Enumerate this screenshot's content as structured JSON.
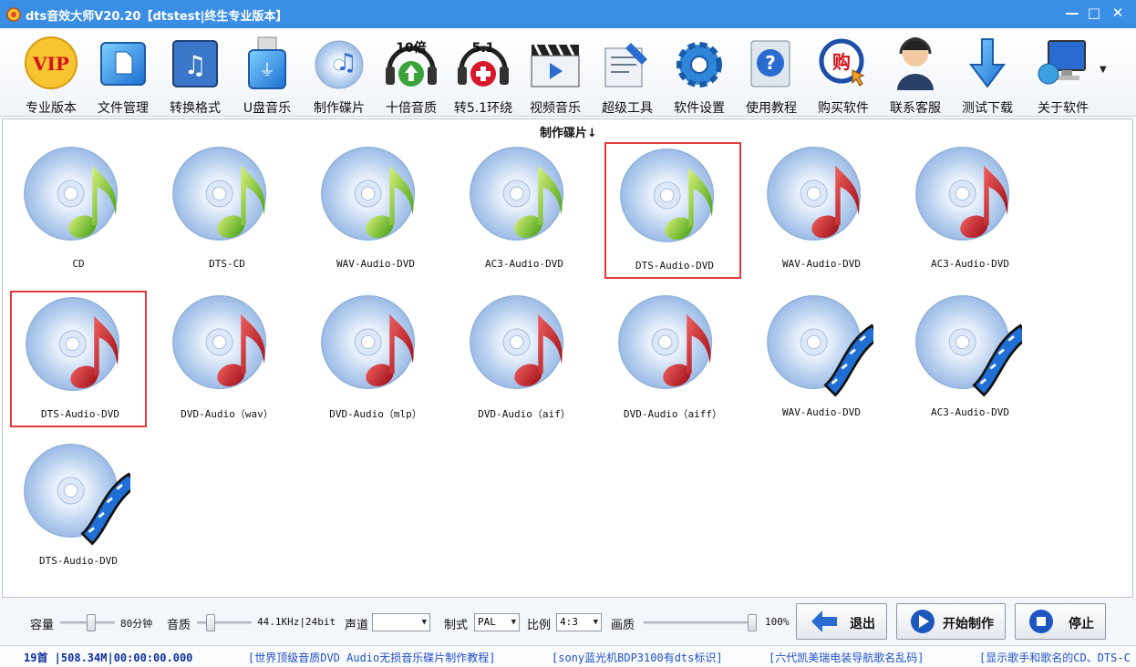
{
  "window": {
    "title": "dts音效大师V20.20【dtstest|终生专业版本】",
    "minimize": "—",
    "maximize": "□",
    "close": "✕"
  },
  "toolbar": {
    "items": [
      {
        "label": "专业版本",
        "icon": "vip-icon"
      },
      {
        "label": "文件管理",
        "icon": "file-manager-icon"
      },
      {
        "label": "转换格式",
        "icon": "convert-music-icon"
      },
      {
        "label": "U盘音乐",
        "icon": "usb-drive-icon"
      },
      {
        "label": "制作碟片",
        "icon": "make-disc-icon"
      },
      {
        "label": "十倍音质",
        "icon": "ten-times-quality-icon"
      },
      {
        "label": "转5.1环绕",
        "icon": "surround-51-icon"
      },
      {
        "label": "视频音乐",
        "icon": "video-music-icon"
      },
      {
        "label": "超级工具",
        "icon": "super-tools-icon"
      },
      {
        "label": "软件设置",
        "icon": "settings-gear-icon"
      },
      {
        "label": "使用教程",
        "icon": "help-tutorial-icon"
      },
      {
        "label": "购买软件",
        "icon": "buy-software-icon"
      },
      {
        "label": "联系客服",
        "icon": "customer-service-icon"
      },
      {
        "label": "测试下载",
        "icon": "download-arrow-icon"
      },
      {
        "label": "关于软件",
        "icon": "about-computer-icon"
      }
    ],
    "badge_10": "10倍",
    "badge_51": "5.1",
    "vip_text": "VIP",
    "buy_char": "购"
  },
  "panel": {
    "title": "制作碟片↓",
    "items": [
      {
        "label": "CD",
        "note": "green",
        "selected": false
      },
      {
        "label": "DTS-CD",
        "note": "green",
        "selected": false
      },
      {
        "label": "WAV-Audio-DVD",
        "note": "green",
        "selected": false
      },
      {
        "label": "AC3-Audio-DVD",
        "note": "green",
        "selected": false
      },
      {
        "label": "DTS-Audio-DVD",
        "note": "green",
        "selected": true
      },
      {
        "label": "WAV-Audio-DVD",
        "note": "red",
        "selected": false
      },
      {
        "label": "AC3-Audio-DVD",
        "note": "red",
        "selected": false
      },
      {
        "label": "DTS-Audio-DVD",
        "note": "red",
        "selected": true
      },
      {
        "label": "DVD-Audio（wav）",
        "note": "red",
        "selected": false
      },
      {
        "label": "DVD-Audio（mlp）",
        "note": "red",
        "selected": false
      },
      {
        "label": "DVD-Audio（aif）",
        "note": "red",
        "selected": false
      },
      {
        "label": "DVD-Audio（aiff）",
        "note": "red",
        "selected": false
      },
      {
        "label": "WAV-Audio-DVD",
        "note": "film",
        "selected": false
      },
      {
        "label": "AC3-Audio-DVD",
        "note": "film",
        "selected": false
      },
      {
        "label": "DTS-Audio-DVD",
        "note": "film",
        "selected": false
      }
    ]
  },
  "controls": {
    "capacity_label": "容量",
    "capacity_value": "80分钟",
    "capacity_level": 0.58,
    "quality_label": "音质",
    "quality_value": "44.1KHz|24bit",
    "quality_level": 0.2,
    "channel_label": "声道",
    "channel_value": "",
    "format_label": "制式",
    "format_value": "PAL",
    "ratio_label": "比例",
    "ratio_value": "4:3",
    "picture_label": "画质",
    "picture_value": "100%",
    "picture_level": 1.0,
    "exit_label": "退出",
    "start_label": "开始制作",
    "stop_label": "停止"
  },
  "status": {
    "count": "19首 |508.34M|00:00:00.000",
    "links": [
      "[世界顶级音质DVD Audio无损音乐碟片制作教程]",
      "[sony蓝光机BDP3100有dts标识]",
      "[六代凯美瑞电装导航歌名乱码]",
      "[显示歌手和歌名的CD、DTS-C"
    ]
  },
  "colors": {
    "titlebar": "#3a8ee6",
    "selection": "#e43a3a",
    "link": "#1e50c8"
  }
}
